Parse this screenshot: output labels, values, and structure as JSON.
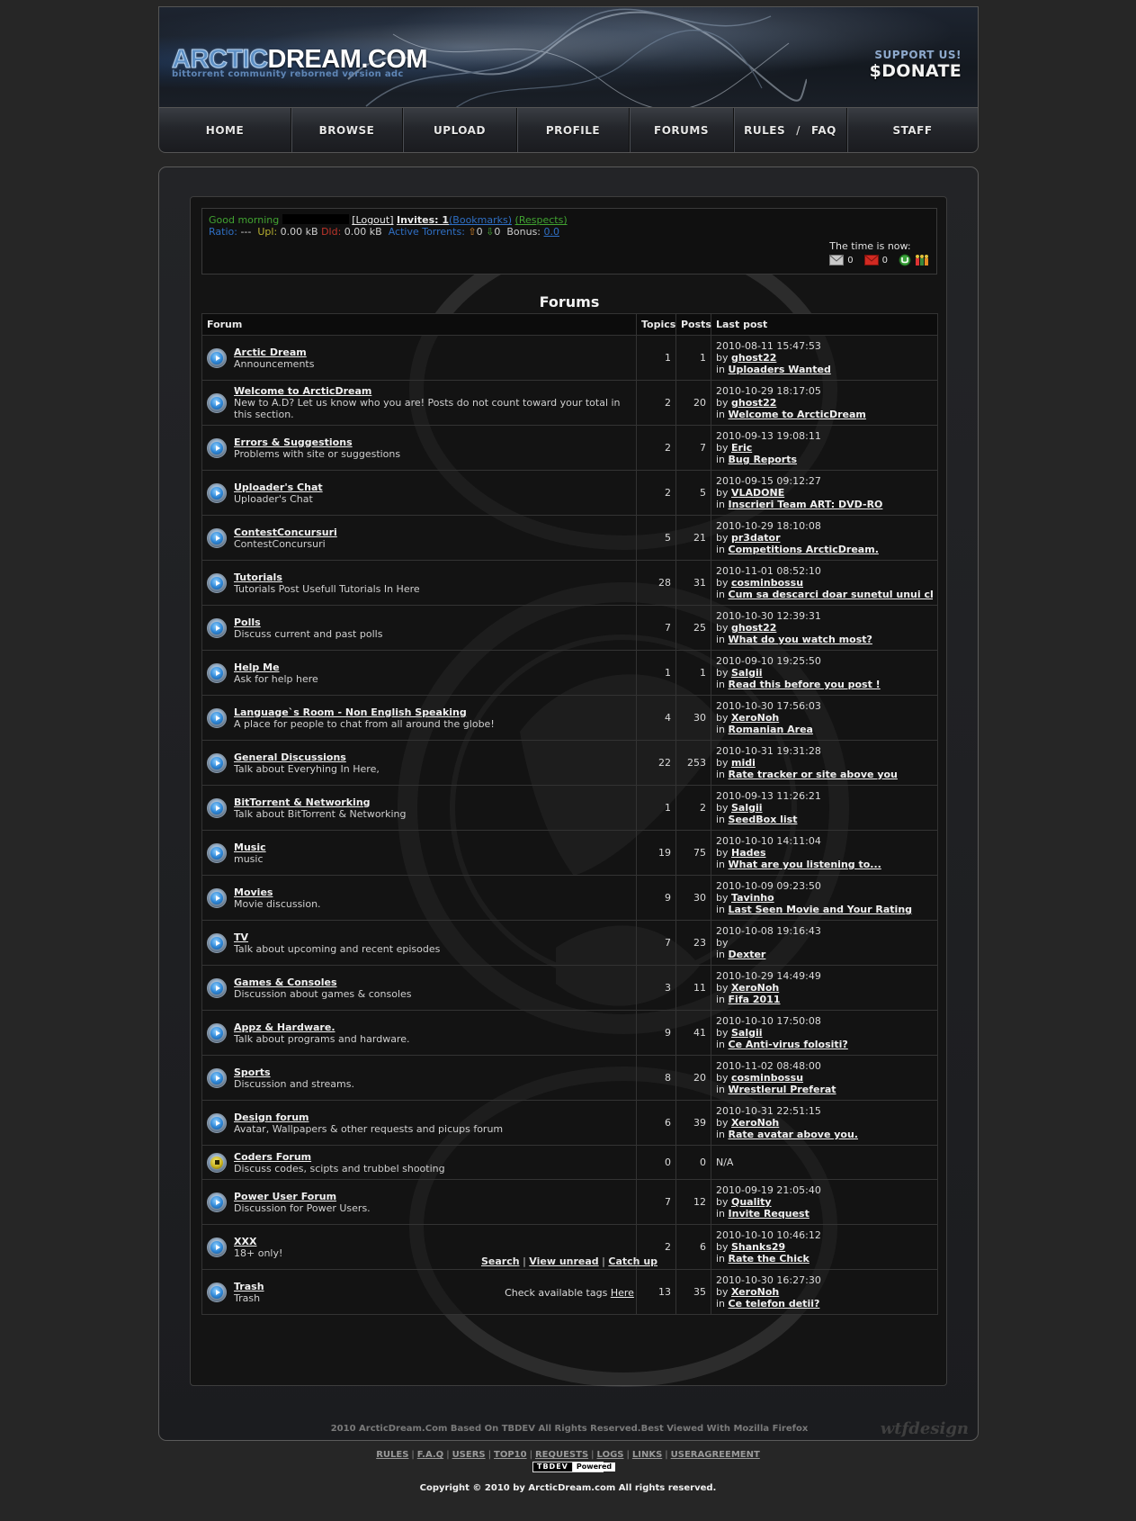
{
  "header": {
    "logo_part1": "ARCTIC",
    "logo_part2": "DREAM.COM",
    "logo_tagline": "bittorrent community reborned version adc",
    "support_label": "SUPPORT US!",
    "donate_label": "$DONATE"
  },
  "nav": {
    "home": "HOME",
    "browse": "BROWSE",
    "upload": "UPLOAD",
    "profile": "PROFILE",
    "forums": "FORUMS",
    "rules": "RULES",
    "slash": "/",
    "faq": "FAQ",
    "staff": "STAFF"
  },
  "userbox": {
    "greeting": "Good morning",
    "logout": "[Logout]",
    "invites": "Invites: 1",
    "bookmarks": "(Bookmarks)",
    "respects": "(Respects)",
    "ratio_label": "Ratio:",
    "ratio_value": "---",
    "upl_label": "Upl:",
    "upl_value": "0.00 kB",
    "dld_label": "Dld:",
    "dld_value": "0.00 kB",
    "active_label": "Active Torrents:",
    "seeding_count": "0",
    "leeching_count": "0",
    "bonus_label": "Bonus:",
    "bonus_value": "0.0",
    "time_label": "The time is now:",
    "messages_count": "0",
    "unread_count": "0"
  },
  "page_title": "Forums",
  "table_headers": {
    "forum": "Forum",
    "topics": "Topics",
    "posts": "Posts",
    "last_post": "Last post"
  },
  "forums": [
    {
      "name": "Arctic Dream",
      "desc": "Announcements",
      "topics": "1",
      "posts": "1",
      "date": "2010-08-11 15:47:53",
      "by": "by",
      "user": "ghost22",
      "in": "in",
      "topic": "Uploaders Wanted"
    },
    {
      "name": "Welcome to ArcticDream",
      "desc": "New to A.D? Let us know who you are! Posts do not count toward your total in this section.",
      "topics": "2",
      "posts": "20",
      "date": "2010-10-29 18:17:05",
      "by": "by",
      "user": "ghost22",
      "in": "in",
      "topic": "Welcome to ArcticDream"
    },
    {
      "name": "Errors & Suggestions",
      "desc": "Problems with site or suggestions",
      "topics": "2",
      "posts": "7",
      "date": "2010-09-13 19:08:11",
      "by": "by",
      "user": "Eric",
      "in": "in",
      "topic": "Bug Reports"
    },
    {
      "name": "Uploader's Chat",
      "desc": "Uploader's Chat",
      "topics": "2",
      "posts": "5",
      "date": "2010-09-15 09:12:27",
      "by": "by",
      "user": "VLADONE",
      "in": "in",
      "topic": "Inscrieri Team ART: DVD-RO"
    },
    {
      "name": "ContestConcursuri",
      "desc": "ContestConcursuri",
      "topics": "5",
      "posts": "21",
      "date": "2010-10-29 18:10:08",
      "by": "by",
      "user": "pr3dator",
      "in": "in",
      "topic": "Competitions ArcticDream."
    },
    {
      "name": "Tutorials",
      "desc": "Tutorials Post Usefull Tutorials In Here",
      "topics": "28",
      "posts": "31",
      "date": "2010-11-01 08:52:10",
      "by": "by",
      "user": "cosminbossu",
      "in": "in",
      "topic": "Cum sa descarci doar sunetul unui clip d"
    },
    {
      "name": "Polls",
      "desc": "Discuss current and past polls",
      "topics": "7",
      "posts": "25",
      "date": "2010-10-30 12:39:31",
      "by": "by",
      "user": "ghost22",
      "in": "in",
      "topic": "What do you watch most?"
    },
    {
      "name": "Help Me",
      "desc": "Ask for help here",
      "topics": "1",
      "posts": "1",
      "date": "2010-09-10 19:25:50",
      "by": "by",
      "user": "Salgii",
      "in": "in",
      "topic": "Read this before you post !"
    },
    {
      "name": "Language`s Room - Non English Speaking",
      "desc": "A place for people to chat from all around the globe!",
      "topics": "4",
      "posts": "30",
      "date": "2010-10-30 17:56:03",
      "by": "by",
      "user": "XeroNoh",
      "in": "in",
      "topic": "Romanian Area"
    },
    {
      "name": "General Discussions",
      "desc": "Talk about Everyhing In Here,",
      "topics": "22",
      "posts": "253",
      "date": "2010-10-31 19:31:28",
      "by": "by",
      "user": "midi",
      "in": "in",
      "topic": "Rate tracker or site above you"
    },
    {
      "name": "BitTorrent & Networking",
      "desc": "Talk about BitTorrent & Networking",
      "topics": "1",
      "posts": "2",
      "date": "2010-09-13 11:26:21",
      "by": "by",
      "user": "Salgii",
      "in": "in",
      "topic": "SeedBox list"
    },
    {
      "name": "Music",
      "desc": "music",
      "topics": "19",
      "posts": "75",
      "date": "2010-10-10 14:11:04",
      "by": "by",
      "user": "Hades",
      "in": "in",
      "topic": "What are you listening to..."
    },
    {
      "name": "Movies",
      "desc": "Movie discussion.",
      "topics": "9",
      "posts": "30",
      "date": "2010-10-09 09:23:50",
      "by": "by",
      "user": "Tavinho",
      "in": "in",
      "topic": "Last Seen Movie and Your Rating"
    },
    {
      "name": "TV",
      "desc": "Talk about upcoming and recent episodes",
      "topics": "7",
      "posts": "23",
      "date": "2010-10-08 19:16:43",
      "by": "by",
      "user": "",
      "in": "in",
      "topic": "Dexter"
    },
    {
      "name": "Games & Consoles",
      "desc": "Discussion about games & consoles",
      "topics": "3",
      "posts": "11",
      "date": "2010-10-29 14:49:49",
      "by": "by",
      "user": "XeroNoh",
      "in": "in",
      "topic": "Fifa 2011"
    },
    {
      "name": "Appz & Hardware.",
      "desc": "Talk about programs and hardware.",
      "topics": "9",
      "posts": "41",
      "date": "2010-10-10 17:50:08",
      "by": "by",
      "user": "Salgii",
      "in": "in",
      "topic": "Ce Anti-virus folositi?"
    },
    {
      "name": "Sports",
      "desc": "Discussion and streams.",
      "topics": "8",
      "posts": "20",
      "date": "2010-11-02 08:48:00",
      "by": "by",
      "user": "cosminbossu",
      "in": "in",
      "topic": "Wrestlerul Preferat"
    },
    {
      "name": "Design forum",
      "desc": "Avatar, Wallpapers & other requests and picups forum",
      "topics": "6",
      "posts": "39",
      "date": "2010-10-31 22:51:15",
      "by": "by",
      "user": "XeroNoh",
      "in": "in",
      "topic": "Rate avatar above you."
    },
    {
      "name": "Coders Forum",
      "desc": "Discuss codes, scipts and trubbel shooting",
      "topics": "0",
      "posts": "0",
      "na": "N/A"
    },
    {
      "name": "Power User Forum",
      "desc": "Discussion for Power Users.",
      "topics": "7",
      "posts": "12",
      "date": "2010-09-19 21:05:40",
      "by": "by",
      "user": "Quality",
      "in": "in",
      "topic": "Invite Request"
    },
    {
      "name": "XXX",
      "desc": "18+ only!",
      "topics": "2",
      "posts": "6",
      "date": "2010-10-10 10:46:12",
      "by": "by",
      "user": "Shanks29",
      "in": "in",
      "topic": "Rate the Chick"
    },
    {
      "name": "Trash",
      "desc": "Trash",
      "topics": "13",
      "posts": "35",
      "date": "2010-10-30 16:27:30",
      "by": "by",
      "user": "XeroNoh",
      "in": "in",
      "topic": "Ce telefon detii?"
    }
  ],
  "bottom_links": {
    "search": "Search",
    "view_unread": "View unread",
    "catch_up": "Catch up",
    "sep": "|"
  },
  "tags": {
    "text": "Check available tags",
    "link": "Here"
  },
  "frame_footer": {
    "copy": "2010 ArcticDream.Com Based On TBDEV All Rights Reserved.Best Viewed With Mozilla Firefox",
    "design": "wtfdesign"
  },
  "footer": {
    "links": [
      "RULES",
      "F.A.Q",
      "USERS",
      "TOP10",
      "REQUESTS",
      "LOGS",
      "LINKS",
      "USERAGREEMENT"
    ],
    "sep": "|",
    "powered_left": "TBDEV",
    "powered_right": "Powered",
    "copyright": "Copyright © 2010 by ArcticDream.com All rights reserved."
  },
  "colors": {
    "background": "#262626",
    "panel": "#141414",
    "greeting": "#41a331",
    "ratio": "#2f6fc4",
    "dld": "#c0352b"
  }
}
